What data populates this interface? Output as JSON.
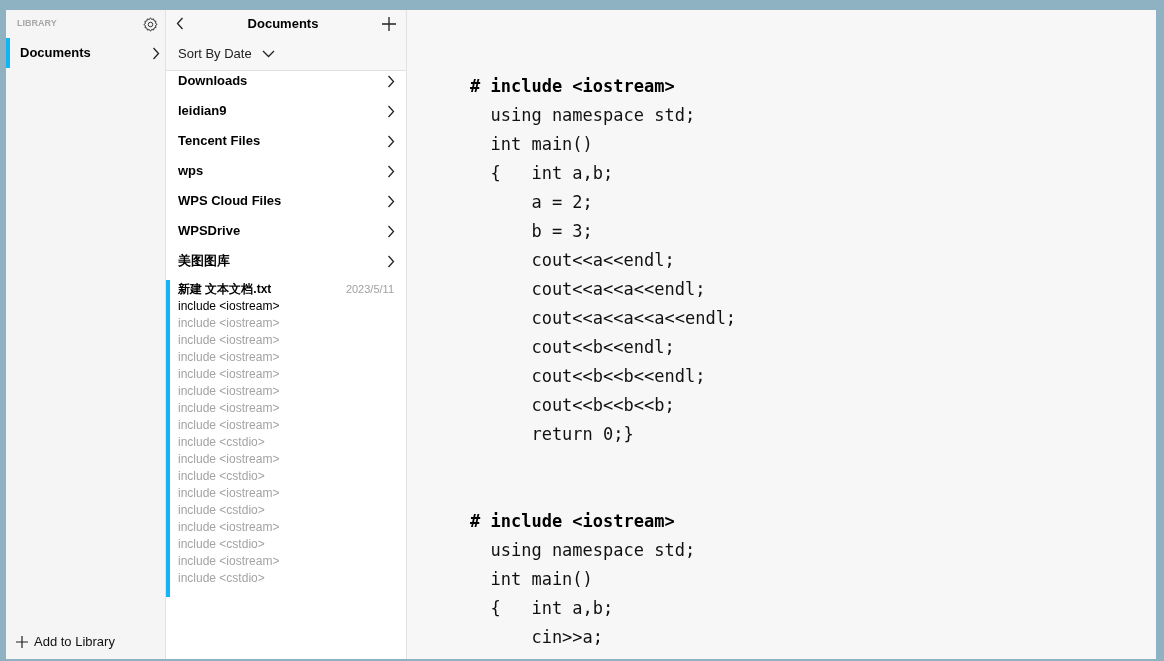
{
  "sidebar": {
    "heading": "LIBRARY",
    "items": [
      {
        "label": "Documents",
        "selected": true
      }
    ],
    "add_button": "Add to Library"
  },
  "list_panel": {
    "title": "Documents",
    "sort": "Sort By Date",
    "folders": [
      {
        "name": "Downloads"
      },
      {
        "name": "leidian9"
      },
      {
        "name": "Tencent Files"
      },
      {
        "name": "wps"
      },
      {
        "name": "WPS Cloud Files"
      },
      {
        "name": "WPSDrive"
      },
      {
        "name": "美图图库"
      }
    ],
    "files": [
      {
        "name": "新建 文本文档.txt",
        "date": "2023/5/11",
        "selected": true,
        "preview": [
          "include <iostream>",
          "include <iostream>",
          "include <iostream>",
          "include <iostream>",
          "include <iostream>",
          "include <iostream>",
          "include <iostream>",
          "include <iostream>",
          "include <cstdio>",
          "include <iostream>",
          "include <cstdio>",
          "include <iostream>",
          "include <cstdio>",
          "include <iostream>",
          "include <cstdio>",
          "include <iostream>",
          "include <cstdio>"
        ]
      }
    ]
  },
  "editor": {
    "blocks": [
      {
        "lines": [
          {
            "kind": "directive",
            "text": "# include <iostream>"
          },
          {
            "kind": "code",
            "text": "  using namespace std;"
          },
          {
            "kind": "code",
            "text": "  int main()"
          },
          {
            "kind": "code",
            "text": "  {   int a,b;"
          },
          {
            "kind": "code",
            "text": "      a = 2;"
          },
          {
            "kind": "code",
            "text": "      b = 3;"
          },
          {
            "kind": "code",
            "text": "      cout<<a<<endl;"
          },
          {
            "kind": "code",
            "text": "      cout<<a<<a<<endl;"
          },
          {
            "kind": "code",
            "text": "      cout<<a<<a<<a<<endl;"
          },
          {
            "kind": "code",
            "text": "      cout<<b<<endl;"
          },
          {
            "kind": "code",
            "text": "      cout<<b<<b<<endl;"
          },
          {
            "kind": "code",
            "text": "      cout<<b<<b<<b;"
          },
          {
            "kind": "code",
            "text": "      return 0;}"
          }
        ]
      },
      {
        "lines": [
          {
            "kind": "directive",
            "text": "# include <iostream>"
          },
          {
            "kind": "code",
            "text": "  using namespace std;"
          },
          {
            "kind": "code",
            "text": "  int main()"
          },
          {
            "kind": "code",
            "text": "  {   int a,b;"
          },
          {
            "kind": "code",
            "text": "      cin>>a;"
          }
        ]
      }
    ]
  }
}
